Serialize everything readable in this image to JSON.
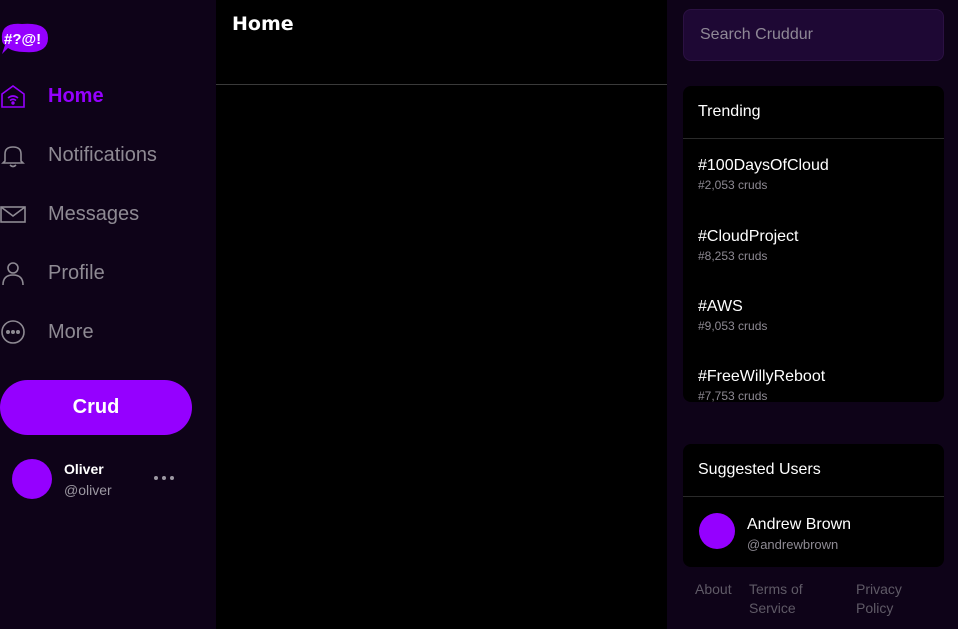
{
  "sidebar": {
    "logo_text": "#?@!",
    "nav": [
      {
        "label": "Home",
        "icon": "home-icon",
        "active": true
      },
      {
        "label": "Notifications",
        "icon": "bell-icon"
      },
      {
        "label": "Messages",
        "icon": "envelope-icon"
      },
      {
        "label": "Profile",
        "icon": "user-icon"
      },
      {
        "label": "More",
        "icon": "more-circle-icon"
      }
    ],
    "crud_button": "Crud",
    "profile": {
      "name": "Oliver",
      "handle": "@oliver"
    }
  },
  "main": {
    "title": "Home"
  },
  "search": {
    "placeholder": "Search Cruddur"
  },
  "trending": {
    "title": "Trending",
    "items": [
      {
        "tag": "#100DaysOfCloud",
        "count": "#2,053 cruds"
      },
      {
        "tag": "#CloudProject",
        "count": "#8,253 cruds"
      },
      {
        "tag": "#AWS",
        "count": "#9,053 cruds"
      },
      {
        "tag": "#FreeWillyReboot",
        "count": "#7,753 cruds"
      }
    ]
  },
  "suggested": {
    "title": "Suggested Users",
    "users": [
      {
        "name": "Andrew Brown",
        "handle": "@andrewbrown"
      }
    ]
  },
  "footer": {
    "about": "About",
    "terms": "Terms of Service",
    "privacy": "Privacy Policy"
  },
  "colors": {
    "accent": "#9500ff",
    "background": "#0e0318",
    "panel": "#000000",
    "search_bg": "#1e0834"
  }
}
